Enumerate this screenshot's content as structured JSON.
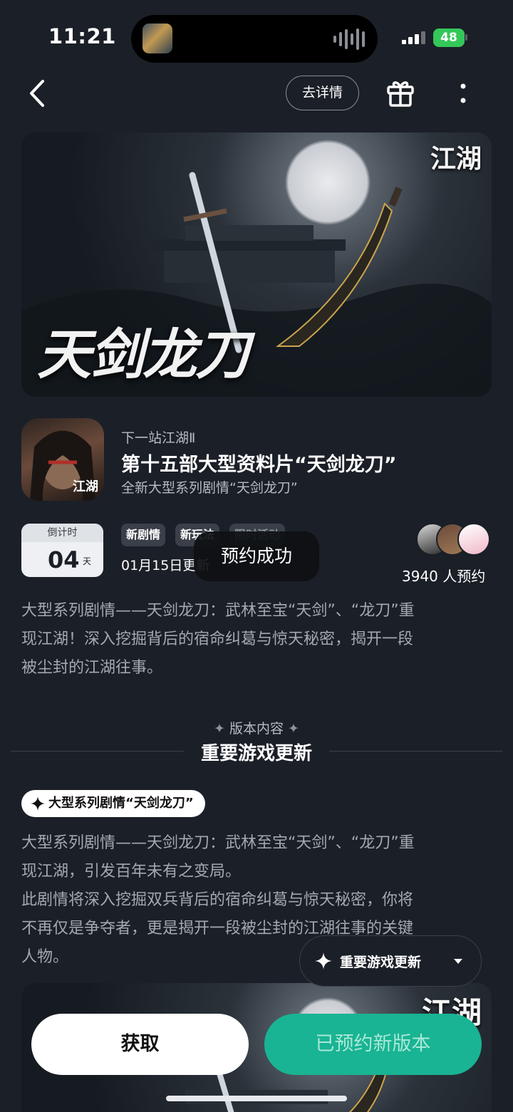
{
  "status_bar": {
    "time": "11:21",
    "battery": "48"
  },
  "nav": {
    "details_label": "去详情"
  },
  "banner": {
    "title": "天剑龙刀",
    "logo": "江湖"
  },
  "app": {
    "name": "下一站江湖Ⅱ",
    "headline": "第十五部大型资料片“天剑龙刀”",
    "subtitle": "全新大型系列剧情“天剑龙刀”",
    "icon_logo": "江湖"
  },
  "countdown": {
    "label": "倒计时",
    "value": "04",
    "unit": "天"
  },
  "tags": [
    "新剧情",
    "新玩法",
    "限时活动"
  ],
  "update_date": "01月15日更新",
  "toast": "预约成功",
  "reservations": {
    "count_text": "3940 人预约"
  },
  "description": [
    "大型系列剧情——天剑龙刀：武林至宝“天剑”、“龙刀”重",
    "现江湖！深入挖掘背后的宿命纠葛与惊天秘密，揭开一段",
    "被尘封的江湖往事。"
  ],
  "section": {
    "kicker": "版本内容",
    "title": "重要游戏更新"
  },
  "feature": {
    "label": "大型系列剧情“天剑龙刀”",
    "body": [
      "大型系列剧情——天剑龙刀：武林至宝“天剑”、“龙刀”重",
      "现江湖，引发百年未有之变局。",
      "此剧情将深入挖掘双兵背后的宿命纠葛与惊天秘密，你将",
      "不再仅是争夺者，更是揭开一段被尘封的江湖往事的关键",
      "人物。"
    ]
  },
  "floating_menu": {
    "label": "重要游戏更新"
  },
  "banner2": {
    "logo": "江湖"
  },
  "actions": {
    "get_label": "获取",
    "reserved_label": "已预约新版本"
  },
  "colors": {
    "background": "#1b1f27",
    "accent": "#19b493",
    "battery": "#34c759"
  }
}
